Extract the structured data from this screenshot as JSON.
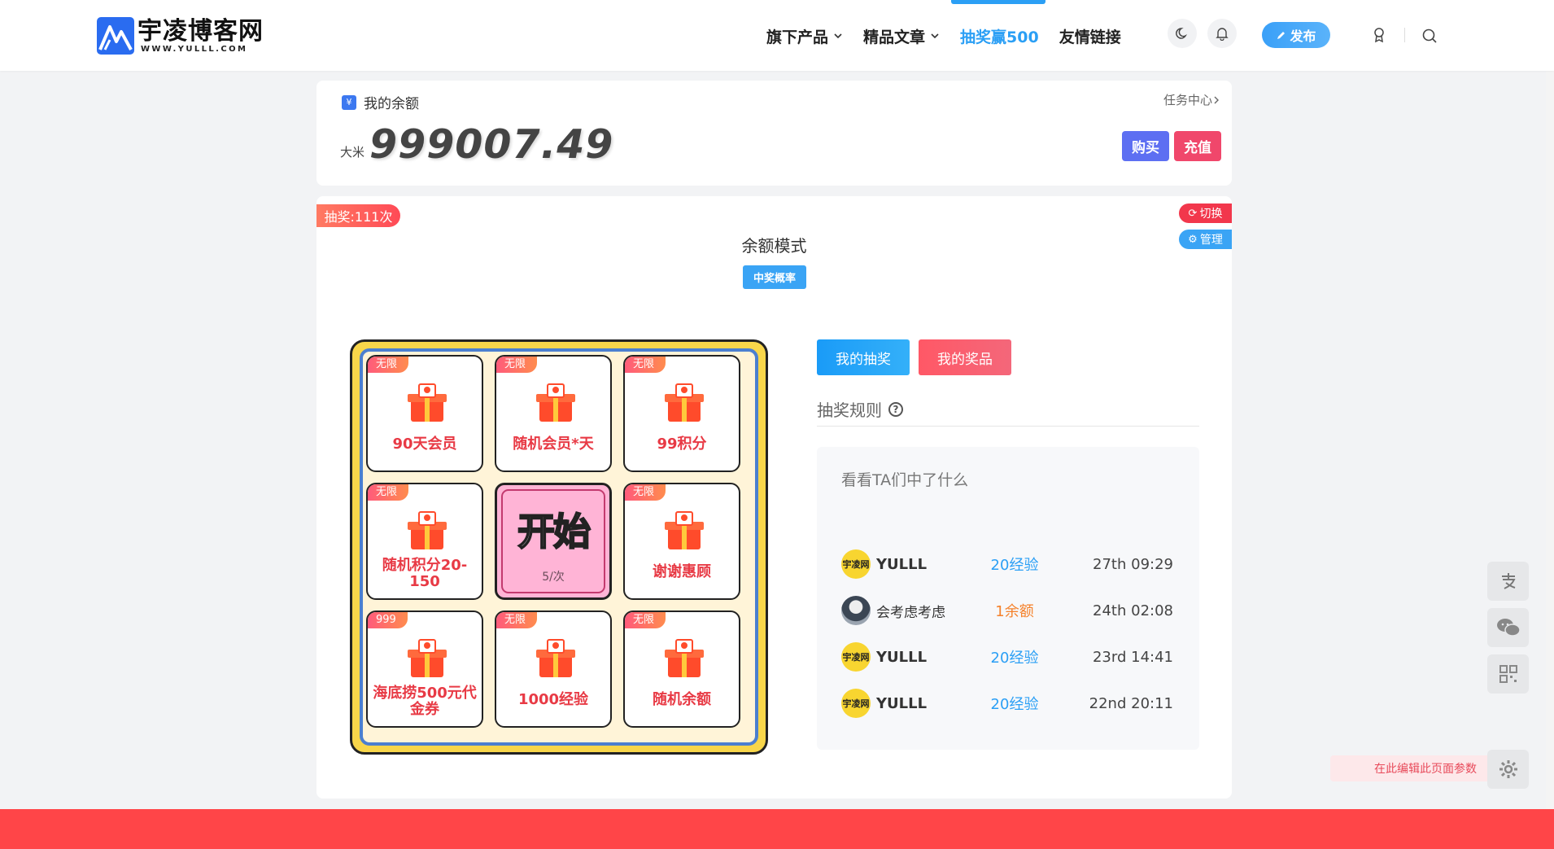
{
  "header": {
    "logo_cn": "宇凌博客网",
    "logo_en": "WWW.YULLL.COM",
    "nav": [
      {
        "label": "旗下产品",
        "dropdown": true
      },
      {
        "label": "精品文章",
        "dropdown": true
      },
      {
        "label": "抽奖赢500",
        "active": true
      },
      {
        "label": "友情链接"
      }
    ],
    "publish_label": "发布",
    "icons": [
      "moon-icon",
      "bell-icon",
      "badge-icon",
      "search-icon"
    ]
  },
  "balance": {
    "title": "我的余额",
    "task_center": "任务中心",
    "unit": "大米",
    "value": "999007.49",
    "buy_label": "购买",
    "recharge_label": "充值"
  },
  "lottery": {
    "draw_count": "抽奖:111次",
    "switch_label": "切换",
    "manage_label": "管理",
    "mode_title": "余额模式",
    "probability_label": "中奖概率",
    "start_label": "开始",
    "start_cost": "5/次",
    "prizes": [
      {
        "tag": "无限",
        "label": "90天会员"
      },
      {
        "tag": "无限",
        "label": "随机会员*天"
      },
      {
        "tag": "无限",
        "label": "99积分"
      },
      {
        "tag": "无限",
        "label": "随机积分20-150"
      },
      {
        "tag": "无限",
        "label": "谢谢惠顾"
      },
      {
        "tag": "999",
        "label": "海底捞500元代金券"
      },
      {
        "tag": "无限",
        "label": "1000经验"
      },
      {
        "tag": "无限",
        "label": "随机余额"
      }
    ],
    "my_draw_label": "我的抽奖",
    "my_prize_label": "我的奖品",
    "rules_label": "抽奖规则",
    "winners_title": "看看TA们中了什么",
    "winners": [
      {
        "avatar": "宇凌网",
        "name": "YULLL",
        "prize": "20经验",
        "time": "27th 09:29",
        "type": "exp"
      },
      {
        "avatar": "",
        "name": "会考虑考虑",
        "prize": "1余额",
        "time": "24th 02:08",
        "type": "balance"
      },
      {
        "avatar": "宇凌网",
        "name": "YULLL",
        "prize": "20经验",
        "time": "23rd 14:41",
        "type": "exp"
      },
      {
        "avatar": "宇凌网",
        "name": "YULLL",
        "prize": "20经验",
        "time": "22nd 20:11",
        "type": "exp"
      }
    ]
  },
  "sidebar_float": {
    "icons": [
      "alipay-icon",
      "wechat-icon",
      "qrcode-icon",
      "gear-icon"
    ],
    "edit_hint": "在此编辑此页面参数"
  }
}
